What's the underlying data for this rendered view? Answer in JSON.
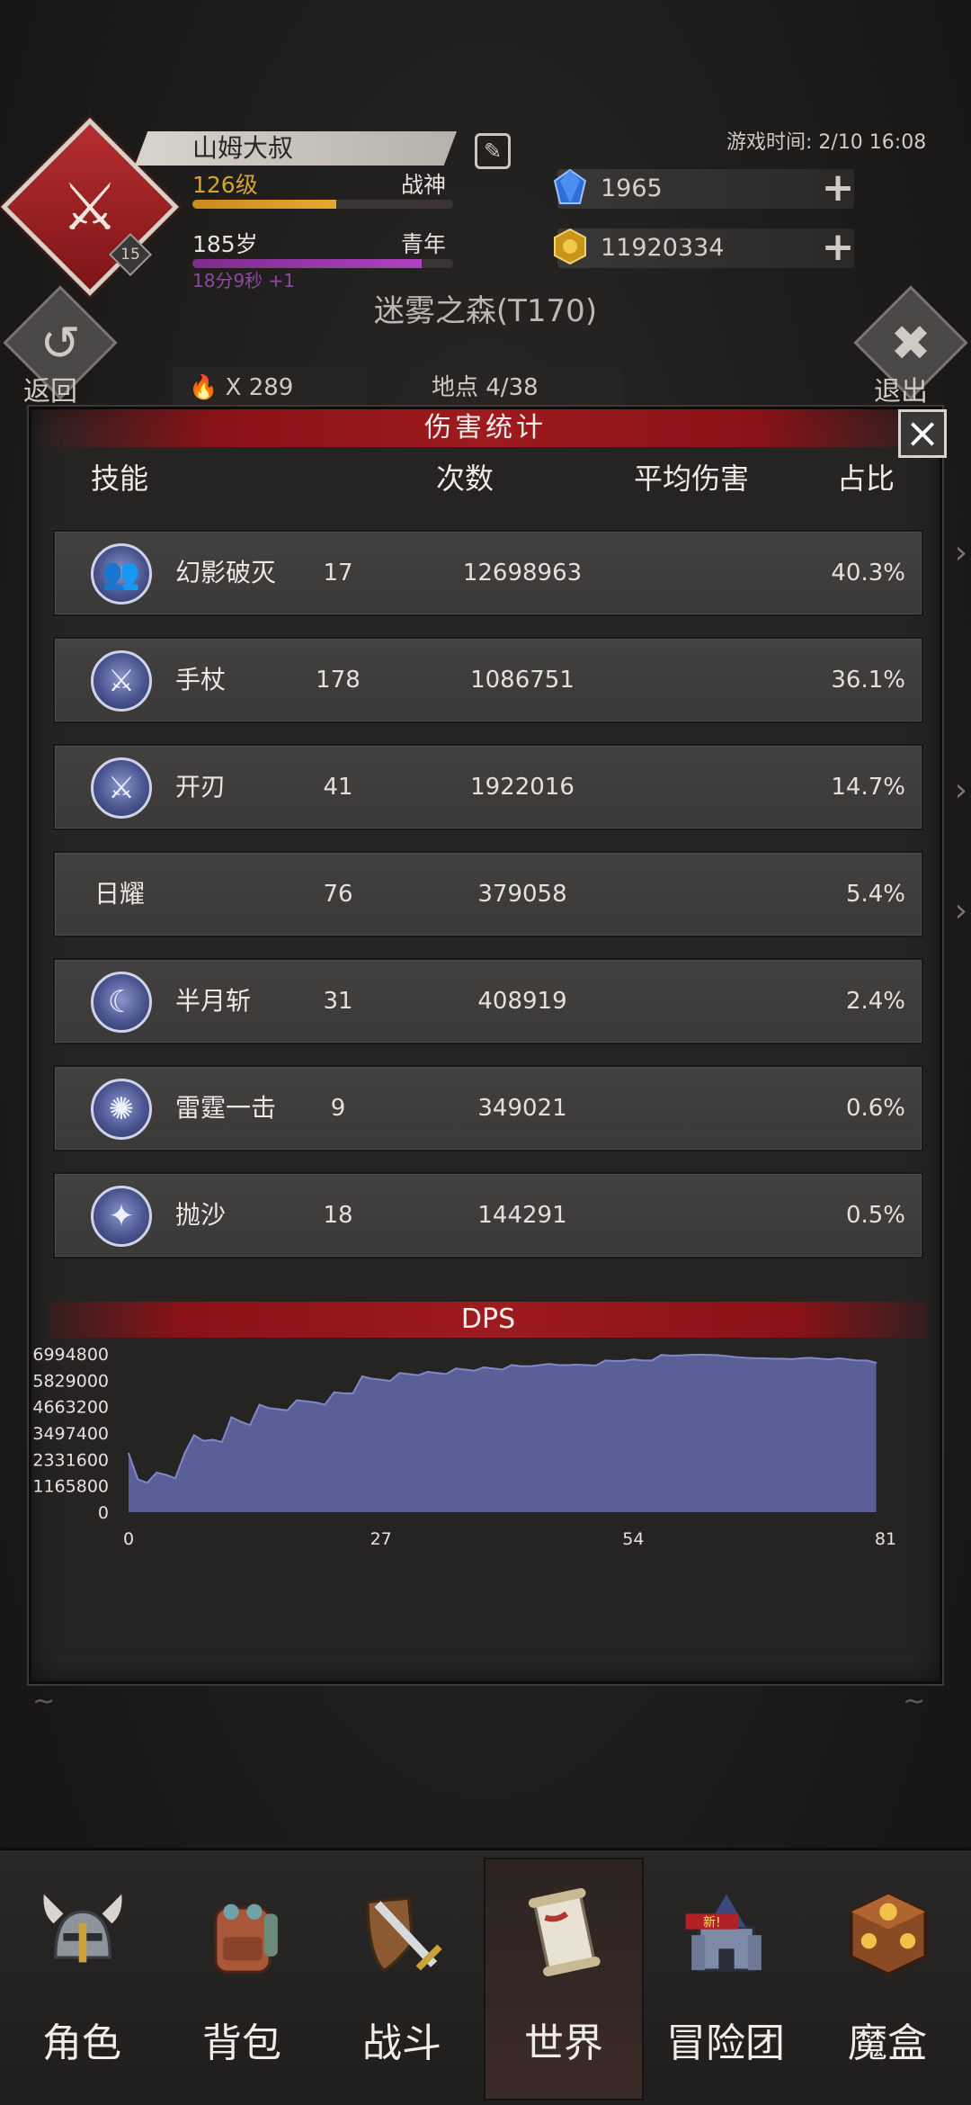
{
  "player": {
    "name": "山姆大叔",
    "avatar_level": "15",
    "level": "126级",
    "title": "战神",
    "age": "185岁",
    "age_stage": "青年",
    "timer": "18分9秒 +1",
    "level_progress": 0.55,
    "age_progress": 0.88
  },
  "game_time": "游戏时间: 2/10 16:08",
  "currency": {
    "gems": "1965",
    "gold": "11920334"
  },
  "map": {
    "location": "迷雾之森(T170)",
    "back_label": "返回",
    "exit_label": "退出",
    "kill_count": "X 289",
    "spot": "地点 4/38"
  },
  "panel": {
    "title": "伤害统计",
    "headers": {
      "skill": "技能",
      "count": "次数",
      "avg": "平均伤害",
      "share": "占比"
    },
    "rows": [
      {
        "name": "幻影破灭",
        "icon": "twin-phantom-icon",
        "count": "17",
        "avg": "12698963",
        "share": "40.3%"
      },
      {
        "name": "手杖",
        "icon": "staff-icon",
        "count": "178",
        "avg": "1086751",
        "share": "36.1%"
      },
      {
        "name": "开刃",
        "icon": "blade-icon",
        "count": "41",
        "avg": "1922016",
        "share": "14.7%"
      },
      {
        "name": "日耀",
        "icon": "",
        "count": "76",
        "avg": "379058",
        "share": "5.4%"
      },
      {
        "name": "半月斩",
        "icon": "crescent-icon",
        "count": "31",
        "avg": "408919",
        "share": "2.4%"
      },
      {
        "name": "雷霆一击",
        "icon": "thunder-icon",
        "count": "9",
        "avg": "349021",
        "share": "0.6%"
      },
      {
        "name": "抛沙",
        "icon": "sand-icon",
        "count": "18",
        "avg": "144291",
        "share": "0.5%"
      }
    ]
  },
  "chart_data": {
    "type": "area",
    "title": "DPS",
    "xlabel": "",
    "ylabel": "",
    "xlim": [
      0,
      81
    ],
    "ylim": [
      0,
      6994800
    ],
    "x_ticks": [
      0,
      27,
      54,
      81
    ],
    "y_ticks": [
      0,
      1165800,
      2331600,
      3497400,
      4663200,
      5829000,
      6994800
    ],
    "x_tick_labels": [
      "0",
      "27",
      "54",
      "81"
    ],
    "y_tick_labels": [
      "0",
      "1165800",
      "2331600",
      "3497400",
      "4663200",
      "5829000",
      "6994800"
    ],
    "fill_color": "#5a5f97",
    "line_color": "#7f87c8",
    "series": [
      {
        "x": [
          0,
          1,
          2,
          3,
          4,
          5,
          6,
          7,
          8,
          9,
          10,
          11,
          12,
          13,
          14,
          15,
          16,
          17,
          18,
          19,
          20,
          21,
          22,
          23,
          24,
          25,
          26,
          27,
          28,
          29,
          30,
          31,
          32,
          33,
          34,
          35,
          36,
          37,
          38,
          39,
          40,
          41,
          42,
          43,
          44,
          45,
          46,
          47,
          48,
          49,
          50,
          51,
          52,
          53,
          54,
          55,
          56,
          57,
          58,
          59,
          60,
          61,
          62,
          63,
          64,
          65,
          66,
          67,
          68,
          69,
          70,
          71,
          72,
          73,
          74,
          75,
          76,
          77,
          78,
          79,
          80
        ],
        "values": [
          2600000,
          1450000,
          1300000,
          1750000,
          1650000,
          1500000,
          2600000,
          3400000,
          3150000,
          3200000,
          3100000,
          4200000,
          4000000,
          3850000,
          4750000,
          4600000,
          4550000,
          4500000,
          4950000,
          4900000,
          4850000,
          4750000,
          5300000,
          5250000,
          5250000,
          6000000,
          5900000,
          5850000,
          5800000,
          6150000,
          6100000,
          6050000,
          6200000,
          6150000,
          6100000,
          6350000,
          6300000,
          6250000,
          6400000,
          6350000,
          6300000,
          6500000,
          6450000,
          6450000,
          6500000,
          6550000,
          6500000,
          6500000,
          6520000,
          6500000,
          6480000,
          6700000,
          6680000,
          6680000,
          6750000,
          6700000,
          6700000,
          6950000,
          6920000,
          6920000,
          6950000,
          6960000,
          6950000,
          6940000,
          6900000,
          6850000,
          6820000,
          6800000,
          6800000,
          6780000,
          6780000,
          6760000,
          6800000,
          6820000,
          6780000,
          6750000,
          6800000,
          6750000,
          6700000,
          6700000,
          6600000
        ]
      }
    ]
  },
  "nav": [
    {
      "label": "角色",
      "icon": "helmet-icon"
    },
    {
      "label": "背包",
      "icon": "backpack-icon"
    },
    {
      "label": "战斗",
      "icon": "sword-shield-icon"
    },
    {
      "label": "世界",
      "icon": "scroll-map-icon",
      "active": true
    },
    {
      "label": "冒险团",
      "icon": "castle-icon",
      "badge": "新!"
    },
    {
      "label": "魔盒",
      "icon": "magic-box-icon"
    }
  ]
}
